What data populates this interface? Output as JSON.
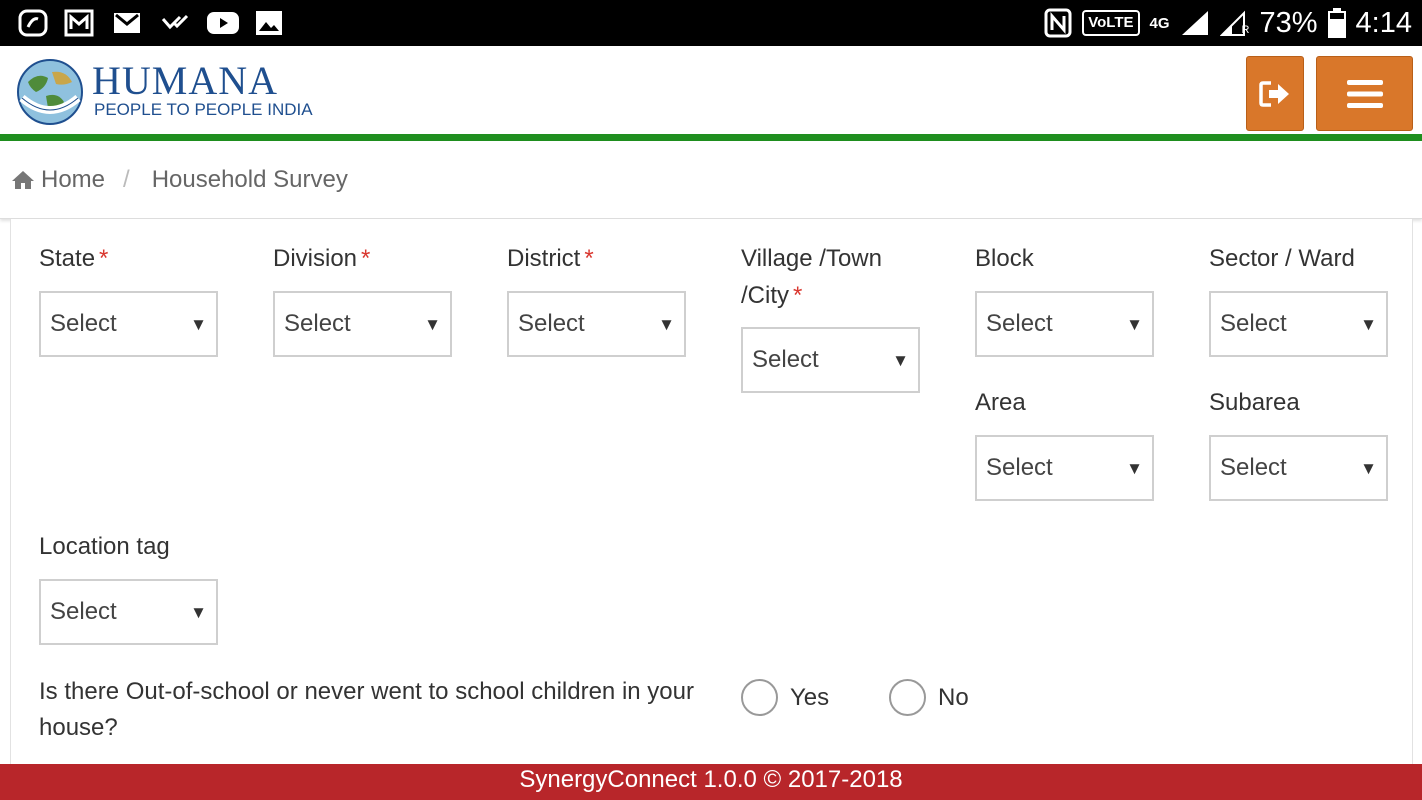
{
  "status_bar": {
    "left_icons": [
      "saavn-icon",
      "newsletter-icon",
      "gmail-icon",
      "check-icon",
      "youtube-icon",
      "photo-icon"
    ],
    "volte": "VoLTE",
    "network": "4G",
    "roaming": "R",
    "battery": "73%",
    "time": "4:14"
  },
  "header": {
    "brand_name": "HUMANA",
    "brand_sub": "PEOPLE TO PEOPLE INDIA",
    "accent_color": "#d9772a",
    "divider_color": "#1f8f1f"
  },
  "breadcrumb": {
    "home": "Home",
    "separator": "/",
    "current": "Household Survey"
  },
  "form": {
    "required_mark": "*",
    "fields": {
      "state": {
        "label": "State",
        "value": "Select",
        "required": true
      },
      "division": {
        "label": "Division",
        "value": "Select",
        "required": true
      },
      "district": {
        "label": "District",
        "value": "Select",
        "required": true
      },
      "village": {
        "label_line1": "Village /Town",
        "label_line2": "/City",
        "value": "Select",
        "required": true
      },
      "block": {
        "label": "Block",
        "value": "Select",
        "required": false
      },
      "sector": {
        "label": "Sector / Ward",
        "value": "Select",
        "required": false
      },
      "area": {
        "label": "Area",
        "value": "Select",
        "required": false
      },
      "subarea": {
        "label": "Subarea",
        "value": "Select",
        "required": false
      },
      "location_tag": {
        "label": "Location tag",
        "value": "Select",
        "required": false
      }
    },
    "question": "Is there Out-of-school or never went to school children in your house?",
    "options": {
      "yes": "Yes",
      "no": "No"
    }
  },
  "footer": {
    "text": "SynergyConnect 1.0.0 © 2017-2018",
    "color": "#b8262a"
  }
}
